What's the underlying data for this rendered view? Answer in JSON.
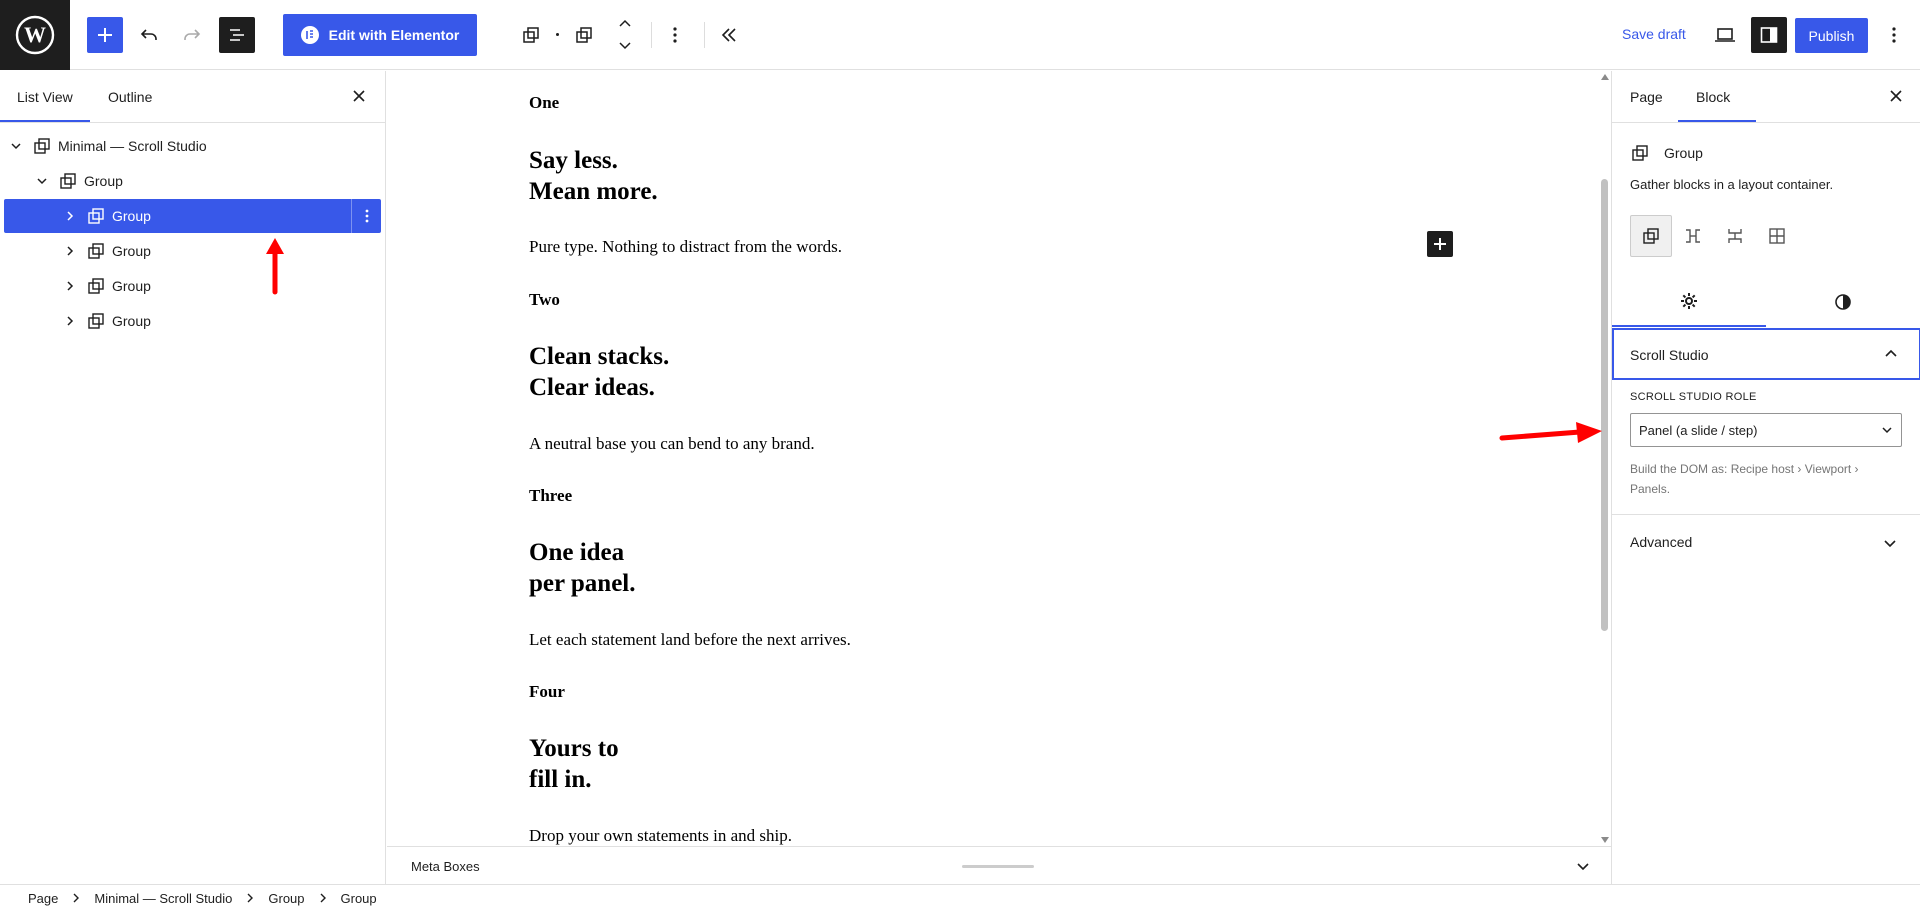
{
  "toolbar": {
    "elementor_label": "Edit with Elementor",
    "save_draft": "Save draft",
    "publish": "Publish"
  },
  "left_panel": {
    "tabs": [
      "List View",
      "Outline"
    ],
    "tree": [
      {
        "label": "Minimal — Scroll Studio",
        "level": 0,
        "expanded": true
      },
      {
        "label": "Group",
        "level": 1,
        "expanded": true
      },
      {
        "label": "Group",
        "level": 2,
        "selected": true
      },
      {
        "label": "Group",
        "level": 2
      },
      {
        "label": "Group",
        "level": 2
      },
      {
        "label": "Group",
        "level": 2
      }
    ]
  },
  "canvas": {
    "panels": [
      {
        "label": "One",
        "heading_1": "Say less.",
        "heading_2": "Mean more.",
        "body": "Pure type. Nothing to distract from the words."
      },
      {
        "label": "Two",
        "heading_1": "Clean stacks.",
        "heading_2": "Clear ideas.",
        "body": "A neutral base you can bend to any brand."
      },
      {
        "label": "Three",
        "heading_1": "One idea",
        "heading_2": "per panel.",
        "body": "Let each statement land before the next arrives."
      },
      {
        "label": "Four",
        "heading_1": "Yours to",
        "heading_2": "fill in.",
        "body": "Drop your own statements in and ship."
      }
    ]
  },
  "meta_boxes": {
    "label": "Meta Boxes"
  },
  "right_panel": {
    "tabs": {
      "page": "Page",
      "block": "Block"
    },
    "block_title": "Group",
    "block_description": "Gather blocks in a layout container.",
    "section_title": "Scroll Studio",
    "role_label": "SCROLL STUDIO ROLE",
    "role_value": "Panel (a slide / step)",
    "role_help": "Build the DOM as: Recipe host › Viewport › Panels.",
    "advanced": "Advanced"
  },
  "breadcrumb": [
    "Page",
    "Minimal — Scroll Studio",
    "Group",
    "Group"
  ],
  "colors": {
    "accent": "#3858e9",
    "dark": "#1e1e1e",
    "annotation": "#ff0000"
  }
}
